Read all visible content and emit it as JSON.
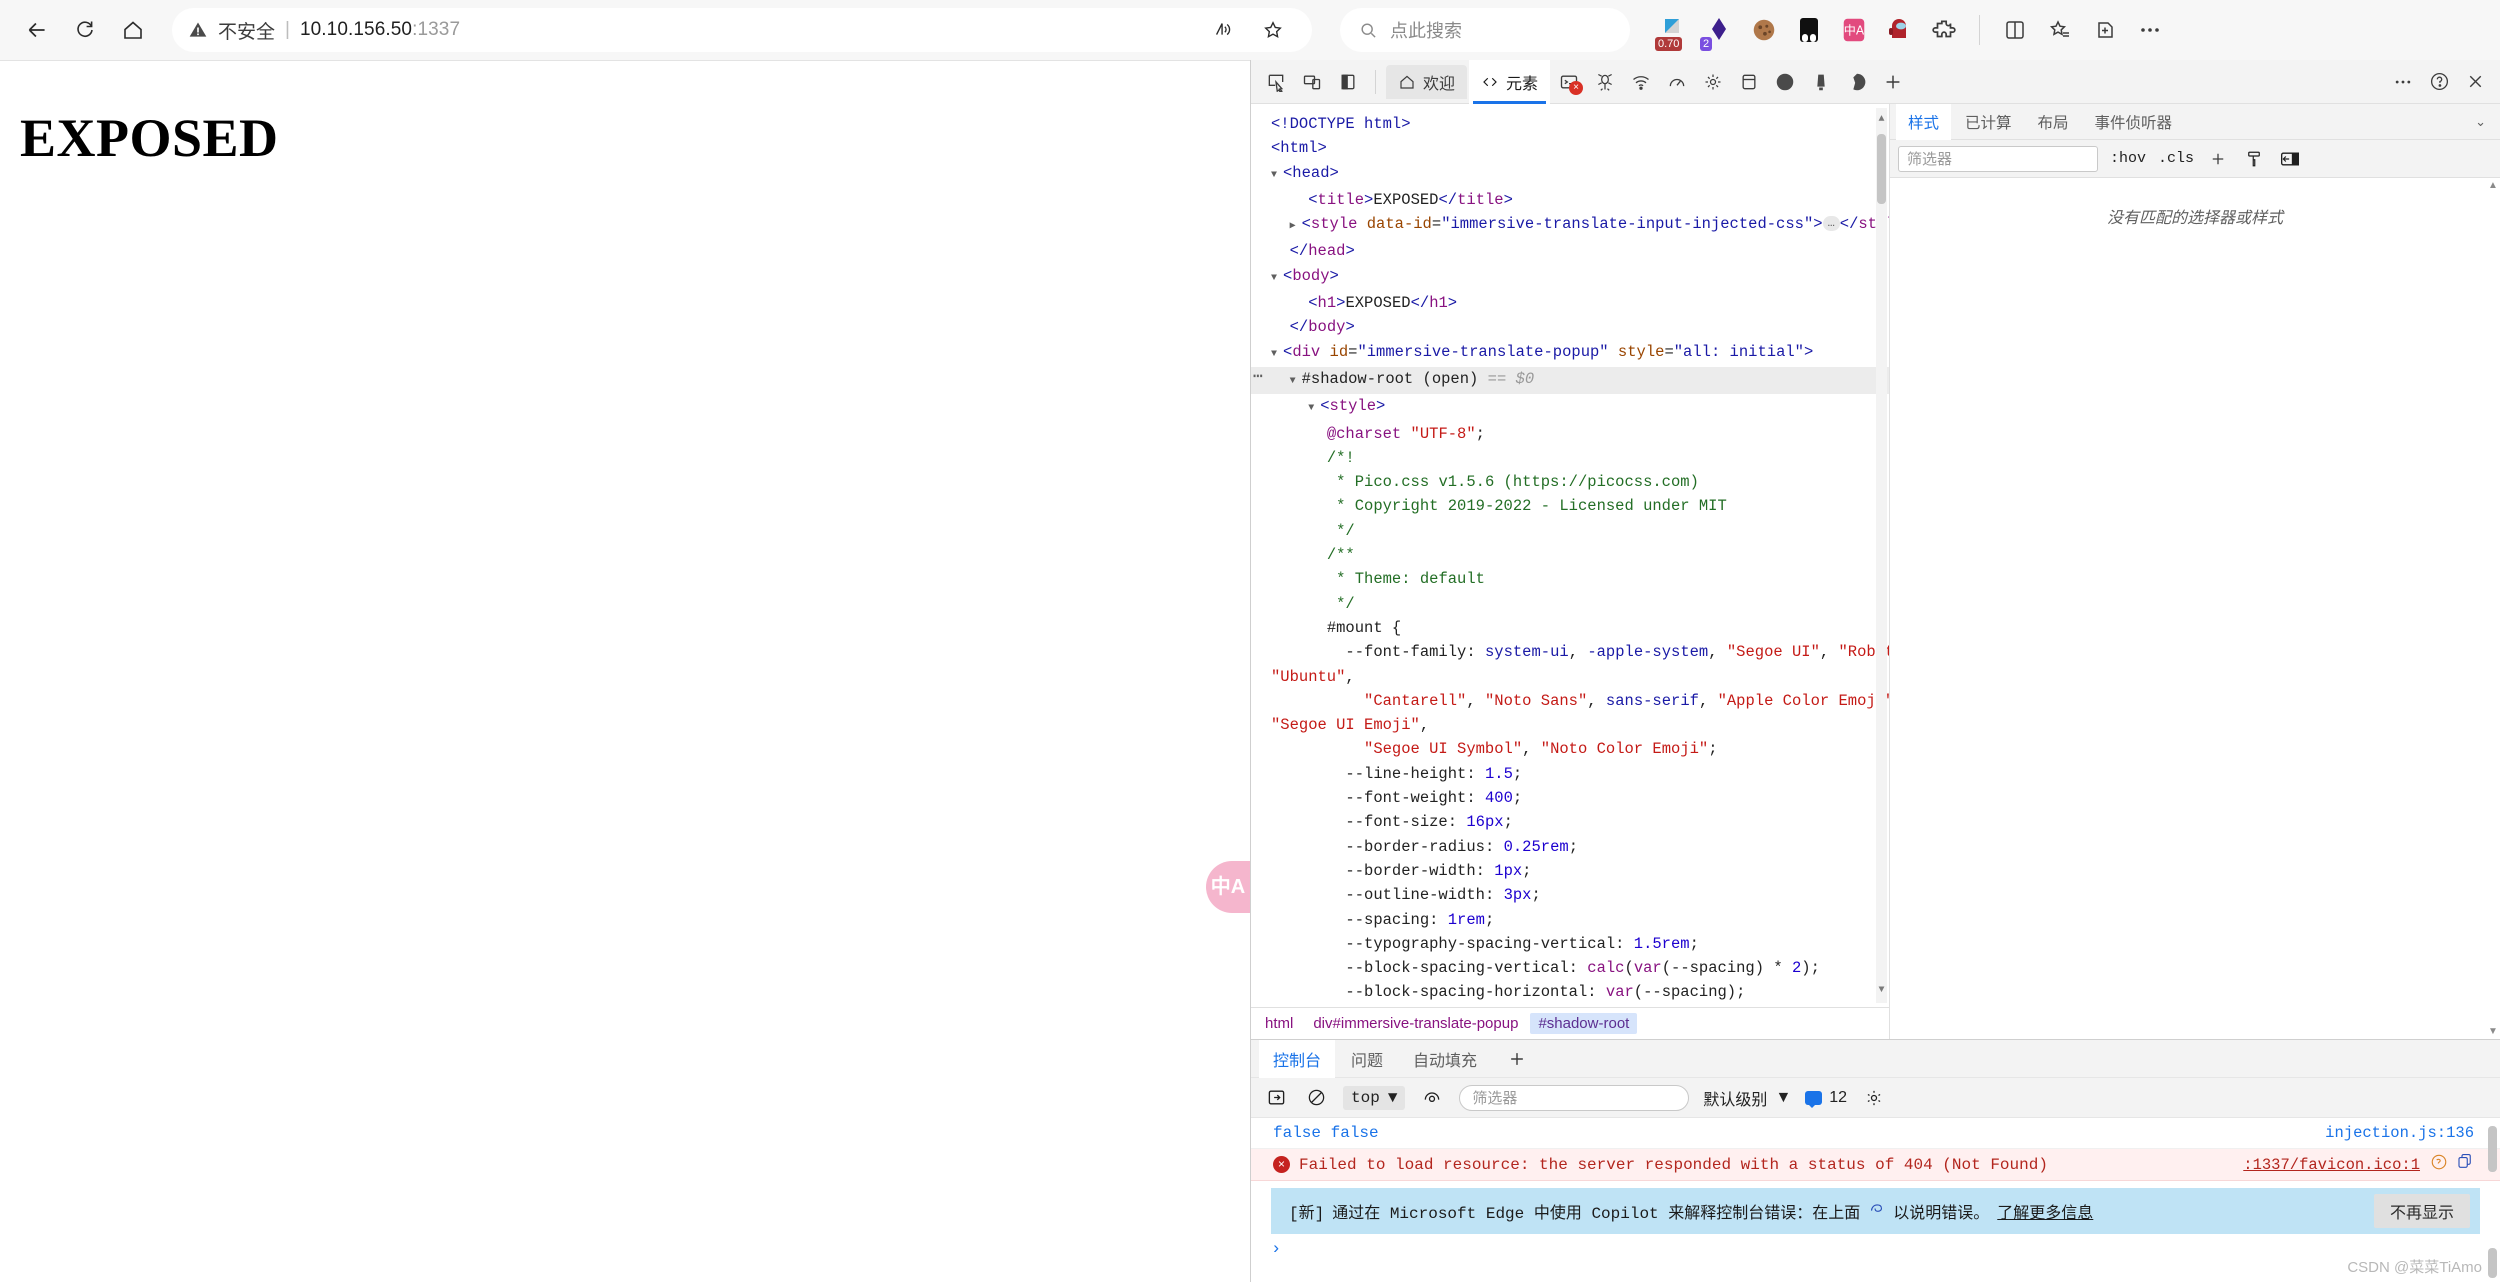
{
  "browser": {
    "nav": {
      "back": "back-arrow",
      "reload": "reload",
      "home": "home"
    },
    "address": {
      "insecure_label": "不安全",
      "url_host": "10.10.156.50",
      "url_port": ":1337",
      "read_aloud": "read-aloud",
      "favorite": "favorite-star"
    },
    "search": {
      "placeholder": "点此搜索"
    },
    "extensions": [
      {
        "name": "ruler-extension",
        "badge": "0.70"
      },
      {
        "name": "diamond-extension",
        "badge": "2"
      },
      {
        "name": "cookie-extension",
        "badge": ""
      },
      {
        "name": "dark-reader-extension",
        "badge": ""
      },
      {
        "name": "immersive-translate-extension",
        "badge": ""
      },
      {
        "name": "among-us-extension",
        "badge": ""
      },
      {
        "name": "puzzle-extension",
        "badge": ""
      }
    ],
    "right_actions": [
      "split-screen",
      "collections",
      "favorites-bar",
      "browser-essentials",
      "settings-more"
    ]
  },
  "page": {
    "heading": "EXPOSED",
    "translate_fab": "中A"
  },
  "devtools": {
    "left_icons": [
      "inspect-element",
      "device-toolbar",
      "dock-side"
    ],
    "tabs": [
      {
        "label": "欢迎",
        "icon": "home-icon",
        "active": false
      },
      {
        "label": "元素",
        "icon": "code-icon",
        "active": true
      }
    ],
    "tool_icons": [
      "console-icon",
      "sources-icon",
      "network-icon",
      "performance-icon",
      "application-icon",
      "memory-icon",
      "panel-icon",
      "lighthouse-icon",
      "recorder-icon",
      "more-tools-icon"
    ],
    "right_icons": [
      "more-options-icon",
      "help-icon",
      "close-icon"
    ],
    "dom": {
      "lines": [
        {
          "indent": 0,
          "html": "<span class=\"tagb\">&lt;!DOCTYPE html&gt;</span>"
        },
        {
          "indent": 0,
          "html": "<span class=\"tagb\">&lt;html&gt;</span>"
        },
        {
          "indent": 0,
          "html": "<span class=\"tri\">▼</span><span class=\"tagb\">&lt;head&gt;</span>"
        }
      ]
    },
    "breadcrumbs": [
      {
        "label": "html",
        "active": false
      },
      {
        "label": "div#immersive-translate-popup",
        "active": false
      },
      {
        "label": "#shadow-root",
        "active": true
      }
    ],
    "styles": {
      "tabs": [
        {
          "label": "样式",
          "active": true
        },
        {
          "label": "已计算",
          "active": false
        },
        {
          "label": "布局",
          "active": false
        },
        {
          "label": "事件侦听器",
          "active": false
        }
      ],
      "filter_placeholder": "筛选器",
      "hov": ":hov",
      "cls": ".cls",
      "add_rule": "+",
      "empty_message": "没有匹配的选择器或样式"
    }
  },
  "drawer": {
    "tabs": [
      {
        "label": "控制台",
        "active": true
      },
      {
        "label": "问题",
        "active": false
      },
      {
        "label": "自动填充",
        "active": false
      }
    ],
    "add_tab": "+",
    "toolbar": {
      "sidebar_toggle": "console-sidebar-icon",
      "clear": "clear-console-icon",
      "context": "top",
      "eye": "live-expression-icon",
      "filter_placeholder": "筛选器",
      "level": "默认级别",
      "issue_count": "12",
      "settings": "settings-gear-icon"
    },
    "messages": [
      {
        "type": "info",
        "text": "false false",
        "source": "injection.js:136"
      },
      {
        "type": "error",
        "text": "Failed to load resource: the server responded with a status of 404 (Not Found)",
        "source": ":1337/favicon.ico:1"
      }
    ],
    "copilot_banner": {
      "tag": "[新]",
      "text": "通过在 Microsoft Edge 中使用 Copilot 来解释控制台错误：在上面",
      "text_after": "以说明错误。",
      "link": "了解更多信息",
      "dismiss": "不再显示"
    },
    "prompt": "›"
  },
  "watermark": "CSDN @菜菜TiAmo",
  "colors": {
    "accent": "#1a73e8",
    "error": "#c5221f",
    "banner": "#bfe3f5",
    "translate_pink": "#f5b6cd"
  }
}
